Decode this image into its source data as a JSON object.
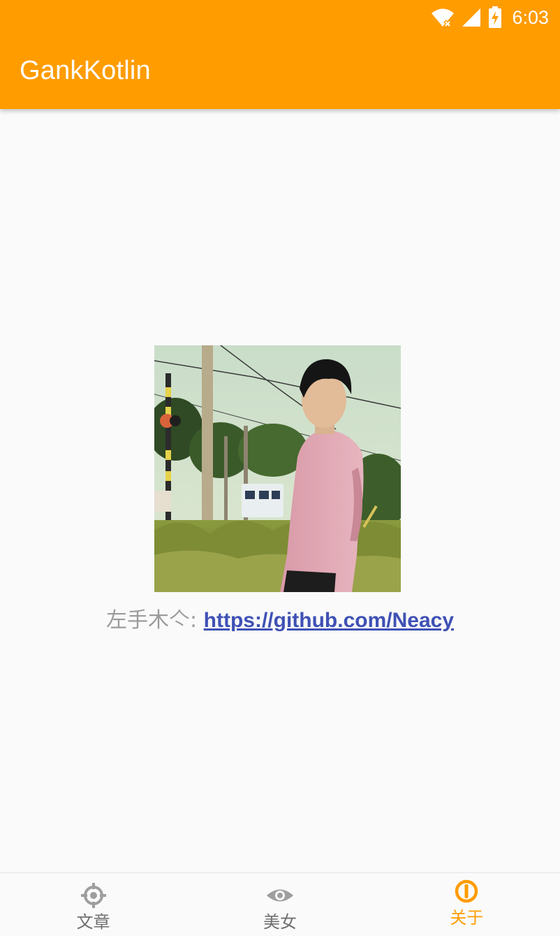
{
  "status_bar": {
    "time": "6:03",
    "icons": [
      "wifi-off-icon",
      "cell-signal-icon",
      "battery-charging-icon"
    ]
  },
  "app_bar": {
    "title": "GankKotlin",
    "color": "#ff9c00"
  },
  "about": {
    "portrait_icon": "portrait-image",
    "author_label": "左手木亽: ",
    "link_text": "https://github.com/Neacy",
    "link_color": "#3f51b5"
  },
  "bottom_nav": {
    "active_color": "#ff9c00",
    "inactive_color": "#9e9e9e",
    "items": [
      {
        "label": "文章",
        "icon": "crosshair-icon",
        "active": false
      },
      {
        "label": "美女",
        "icon": "eye-icon",
        "active": false
      },
      {
        "label": "关于",
        "icon": "power-icon",
        "active": true
      }
    ]
  }
}
